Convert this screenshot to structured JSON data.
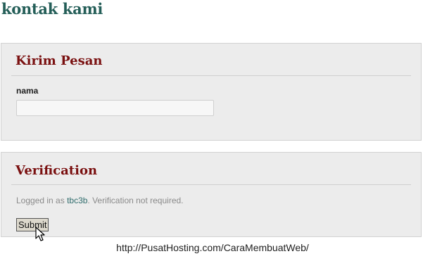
{
  "page": {
    "title": "kontak kami"
  },
  "message_panel": {
    "heading": "Kirim Pesan",
    "name_label": "nama",
    "name_value": "",
    "name_placeholder": ""
  },
  "verification_panel": {
    "heading": "Verification",
    "login_prefix": "Logged in as ",
    "username": "tbc3b",
    "login_suffix": ". Verification not required.",
    "submit_label": "Submit"
  },
  "footer": {
    "url_text": "http://PusatHosting.com/CaraMembuatWeb/"
  },
  "colors": {
    "title": "#245e58",
    "heading": "#7a1010",
    "panel_bg": "#ececec",
    "username_link": "#2f6c6c"
  },
  "icons": {
    "cursor": "mouse-pointer-icon"
  }
}
